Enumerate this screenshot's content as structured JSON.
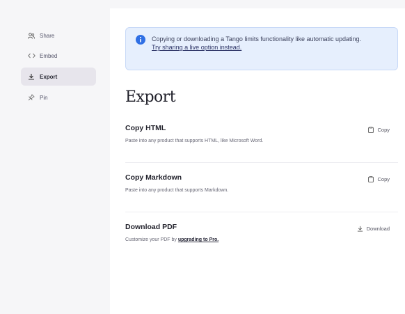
{
  "corner_mark": "r",
  "sidebar": {
    "items": [
      {
        "label": "Share",
        "icon": "share-people-icon"
      },
      {
        "label": "Embed",
        "icon": "code-icon"
      },
      {
        "label": "Export",
        "icon": "download-icon",
        "active": true
      },
      {
        "label": "Pin",
        "icon": "pin-icon"
      }
    ]
  },
  "banner": {
    "icon": "info-icon",
    "text": "Copying or downloading a Tango limits functionality like automatic updating.",
    "link": "Try sharing a live option instead.",
    "accent_color": "#2f6fe4"
  },
  "page": {
    "title": "Export"
  },
  "options": [
    {
      "title": "Copy HTML",
      "description": "Paste into any product that supports HTML, like Microsoft Word.",
      "action_label": "Copy",
      "action_icon": "clipboard-icon"
    },
    {
      "title": "Copy Markdown",
      "description": "Paste into any product that supports Markdown.",
      "action_label": "Copy",
      "action_icon": "clipboard-icon"
    },
    {
      "title": "Download PDF",
      "description_prefix": "Customize your PDF by ",
      "description_link": "upgrading to Pro.",
      "action_label": "Download",
      "action_icon": "download-icon"
    }
  ]
}
